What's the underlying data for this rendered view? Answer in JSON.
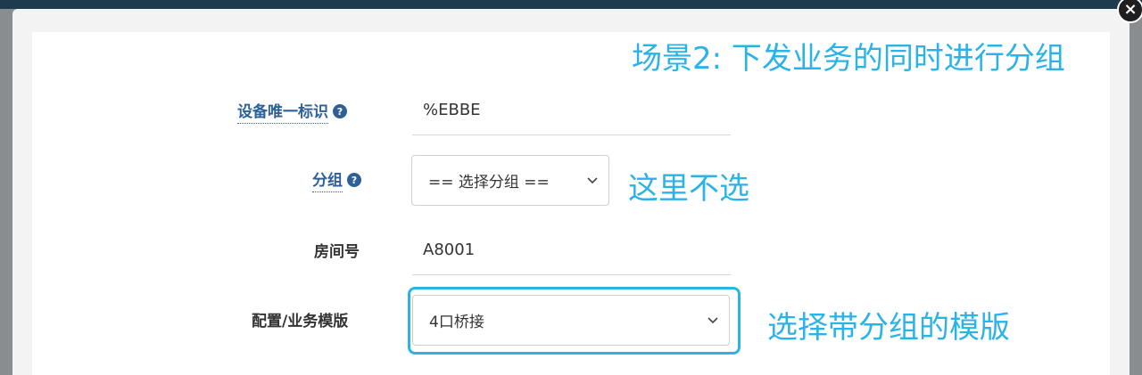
{
  "annotations": {
    "scenario": "场景2: 下发业务的同时进行分组",
    "group_note": "这里不选",
    "template_note": "选择带分组的模版"
  },
  "form": {
    "device_id": {
      "label": "设备唯一标识",
      "help_icon": "question-circle-icon",
      "value": "%EBBE"
    },
    "group": {
      "label": "分组",
      "help_icon": "question-circle-icon",
      "selected": "== 选择分组 =="
    },
    "room": {
      "label": "房间号",
      "value": "A8001"
    },
    "template": {
      "label": "配置/业务模版",
      "selected": "4口桥接"
    }
  },
  "icons": {
    "close": "close-icon",
    "help_glyph": "?",
    "close_glyph": "×"
  },
  "colors": {
    "annotation": "#2bb3e8",
    "link_label": "#2d5f99",
    "highlight_border": "#2bb3e8"
  }
}
